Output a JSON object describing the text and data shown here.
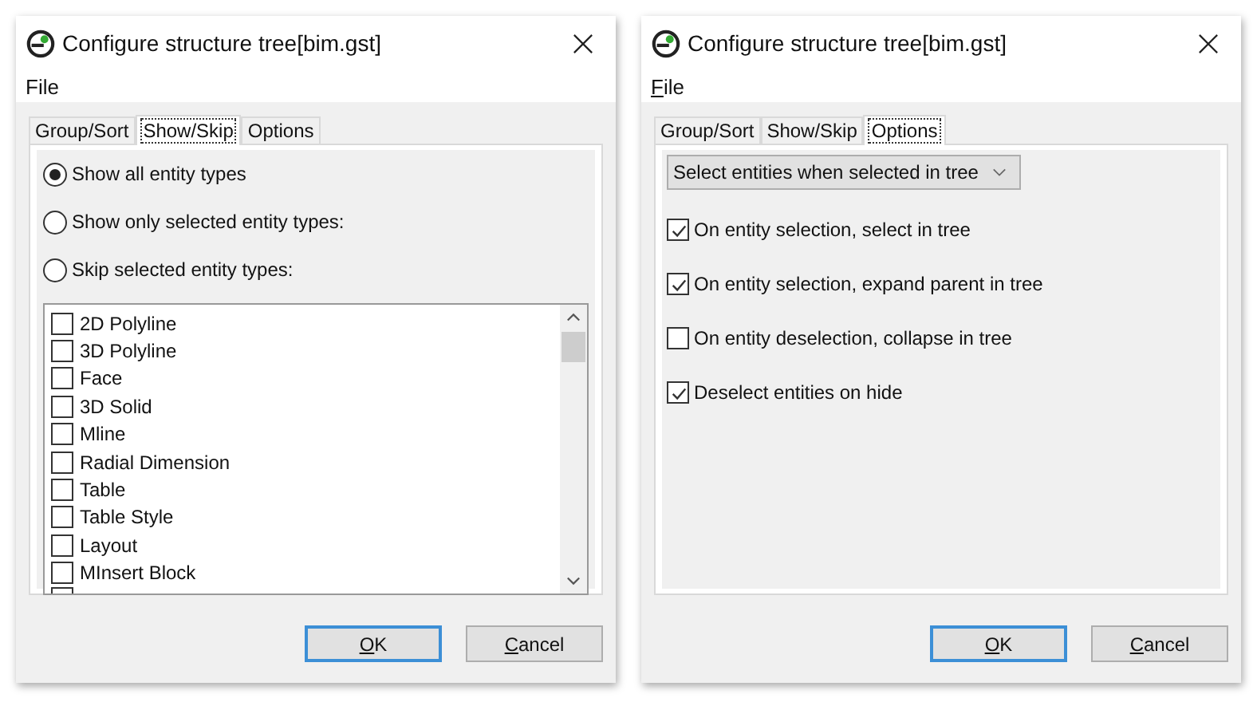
{
  "dialogs": [
    {
      "title": "Configure structure tree[bim.gst]",
      "menu": [
        {
          "label": "File",
          "underline_first": false
        }
      ],
      "tabs": [
        {
          "label": "Group/Sort",
          "selected": false
        },
        {
          "label": "Show/Skip",
          "selected": true
        },
        {
          "label": "Options",
          "selected": false
        }
      ],
      "panel": {
        "kind": "show_skip",
        "radios": [
          {
            "label": "Show all entity types",
            "selected": true
          },
          {
            "label": "Show only selected entity types:",
            "selected": false
          },
          {
            "label": "Skip selected entity types:",
            "selected": false
          }
        ],
        "list": [
          {
            "label": "2D Polyline",
            "checked": false
          },
          {
            "label": "3D Polyline",
            "checked": false
          },
          {
            "label": "Face",
            "checked": false
          },
          {
            "label": "3D Solid",
            "checked": false
          },
          {
            "label": "Mline",
            "checked": false
          },
          {
            "label": "Radial Dimension",
            "checked": false
          },
          {
            "label": "Table",
            "checked": false
          },
          {
            "label": "Table Style",
            "checked": false
          },
          {
            "label": "Layout",
            "checked": false
          },
          {
            "label": "MInsert Block",
            "checked": false
          }
        ]
      },
      "buttons": [
        {
          "label": "OK",
          "underline_first": true,
          "default": true
        },
        {
          "label": "Cancel",
          "underline_first": true,
          "default": false
        }
      ]
    },
    {
      "title": "Configure structure tree[bim.gst]",
      "menu": [
        {
          "label": "File",
          "underline_first": true
        }
      ],
      "tabs": [
        {
          "label": "Group/Sort",
          "selected": false
        },
        {
          "label": "Show/Skip",
          "selected": false
        },
        {
          "label": "Options",
          "selected": true
        }
      ],
      "panel": {
        "kind": "options",
        "dropdown": {
          "value": "Select entities when selected in tree"
        },
        "checkboxes": [
          {
            "label": "On entity selection, select in tree",
            "checked": true
          },
          {
            "label": "On entity selection, expand parent in tree",
            "checked": true
          },
          {
            "label": "On entity deselection, collapse in tree",
            "checked": false
          },
          {
            "label": "Deselect entities on hide",
            "checked": true
          }
        ]
      },
      "buttons": [
        {
          "label": "OK",
          "underline_first": true,
          "default": true
        },
        {
          "label": "Cancel",
          "underline_first": true,
          "default": false
        }
      ]
    }
  ]
}
